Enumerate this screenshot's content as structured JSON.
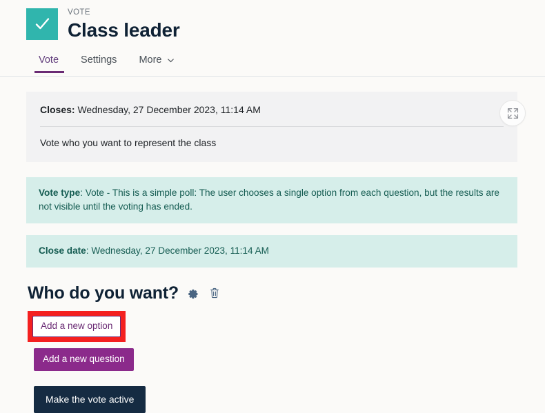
{
  "header": {
    "eyebrow": "VOTE",
    "title": "Class leader",
    "icon": "check-icon",
    "icon_color": "#30b5ad"
  },
  "tabs": {
    "items": [
      {
        "label": "Vote",
        "active": true
      },
      {
        "label": "Settings",
        "active": false
      },
      {
        "label": "More",
        "active": false,
        "caret": "chevron-down-icon"
      }
    ],
    "active_underline_color": "#6a2a74"
  },
  "intro": {
    "closes_label": "Closes:",
    "closes_value": "Wednesday, 27 December 2023, 11:14 AM",
    "description": "Vote who you want to represent the class",
    "expand_icon": "expand-arrows-icon"
  },
  "vote_type": {
    "label": "Vote type",
    "separator": ": ",
    "value": "Vote - This is a simple poll: The user chooses a single option from each question, but the results are not visible until the voting has ended.",
    "background": "#d6eeea",
    "text_color": "#155c52"
  },
  "close_date": {
    "label": "Close date",
    "separator": ": ",
    "value": "Wednesday, 27 December 2023, 11:14 AM",
    "background": "#d6eeea",
    "text_color": "#155c52"
  },
  "question": {
    "title": "Who do you want?",
    "settings_icon": "gear-icon",
    "delete_icon": "trash-icon"
  },
  "actions": {
    "add_option_label": "Add a new option",
    "add_option_highlight_color": "#f42020",
    "add_question_label": "Add a new question",
    "add_question_color": "#8b2a8b",
    "make_active_label": "Make the vote active",
    "make_active_color": "#152b42"
  }
}
